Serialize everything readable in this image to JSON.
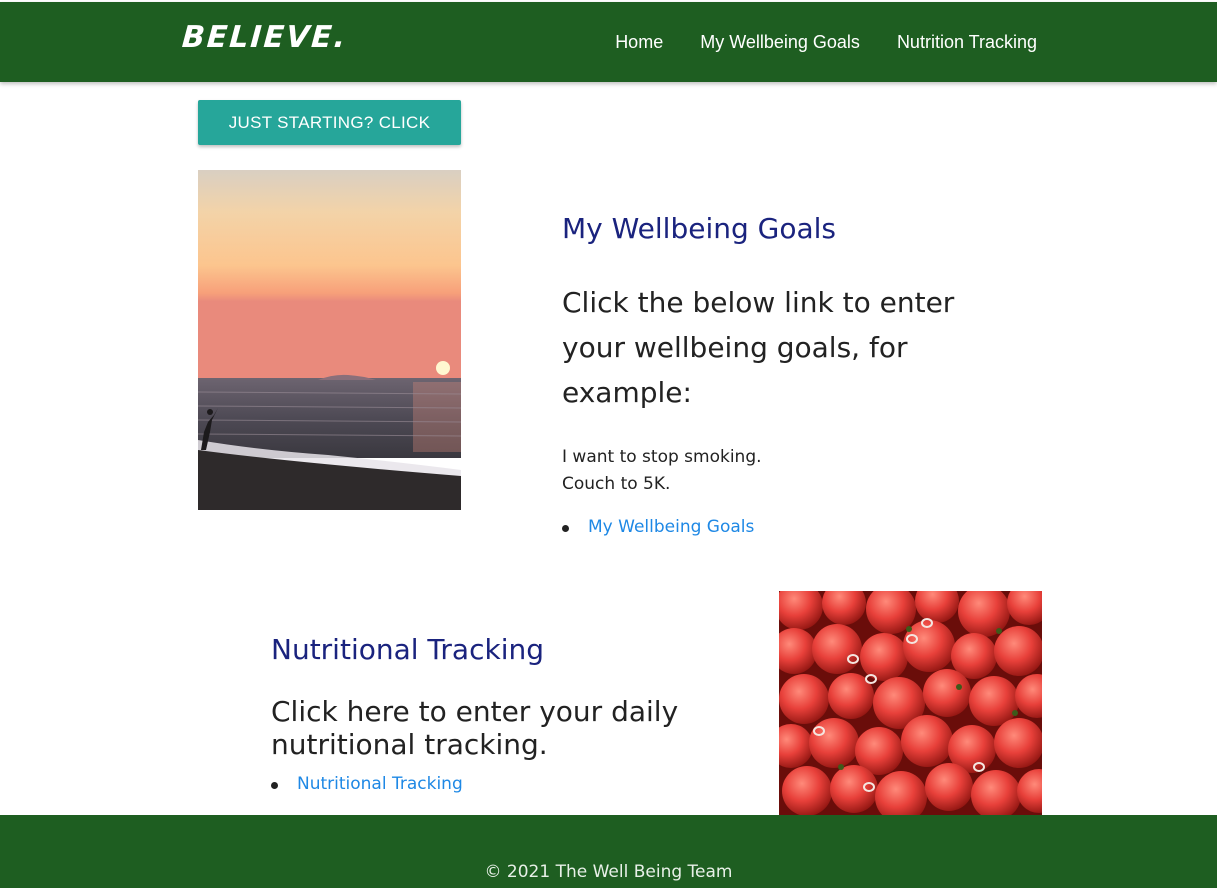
{
  "navbar": {
    "brand": "BELIEVE.",
    "links": [
      "Home",
      "My Wellbeing Goals",
      "Nutrition Tracking"
    ],
    "background": "#1e5e21"
  },
  "start_button": {
    "label": "JUST STARTING? CLICK",
    "color": "#26a69a"
  },
  "goals": {
    "title": "My Wellbeing Goals",
    "subtitle": "Click the below link to enter your wellbeing goals, for example:",
    "examples": [
      "I want to stop smoking.",
      "Couch to 5K."
    ],
    "link": "My Wellbeing Goals"
  },
  "nutrition": {
    "title": "Nutritional Tracking",
    "subtitle": "Click here to enter your daily nutritional tracking.",
    "link": "Nutritional Tracking"
  },
  "footer": {
    "text": "© 2021 The Well Being Team"
  },
  "colors": {
    "heading": "#1a237e",
    "link": "#1e88e5"
  }
}
